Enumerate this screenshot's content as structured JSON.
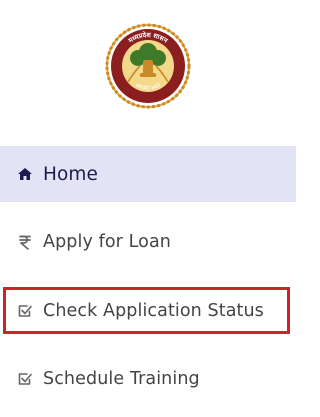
{
  "logo": {
    "emblem_text_top": "मध्यप्रदेश शासन",
    "emblem_text_bottom": "सत्यमेव जयते"
  },
  "nav": {
    "items": [
      {
        "id": "home",
        "label": "Home",
        "icon": "home-icon",
        "active": true
      },
      {
        "id": "loan",
        "label": "Apply for Loan",
        "icon": "rupee-icon"
      },
      {
        "id": "status",
        "label": "Check Application Status",
        "icon": "checkbox-icon",
        "highlighted": true
      },
      {
        "id": "training",
        "label": "Schedule Training",
        "icon": "checkbox-icon"
      }
    ]
  },
  "colors": {
    "active_bg": "#e3e3f6",
    "active_text": "#1c1a4e",
    "highlight_border": "#d1222b",
    "emblem_gold": "#c98a2a",
    "emblem_maroon": "#8b1f1f"
  }
}
